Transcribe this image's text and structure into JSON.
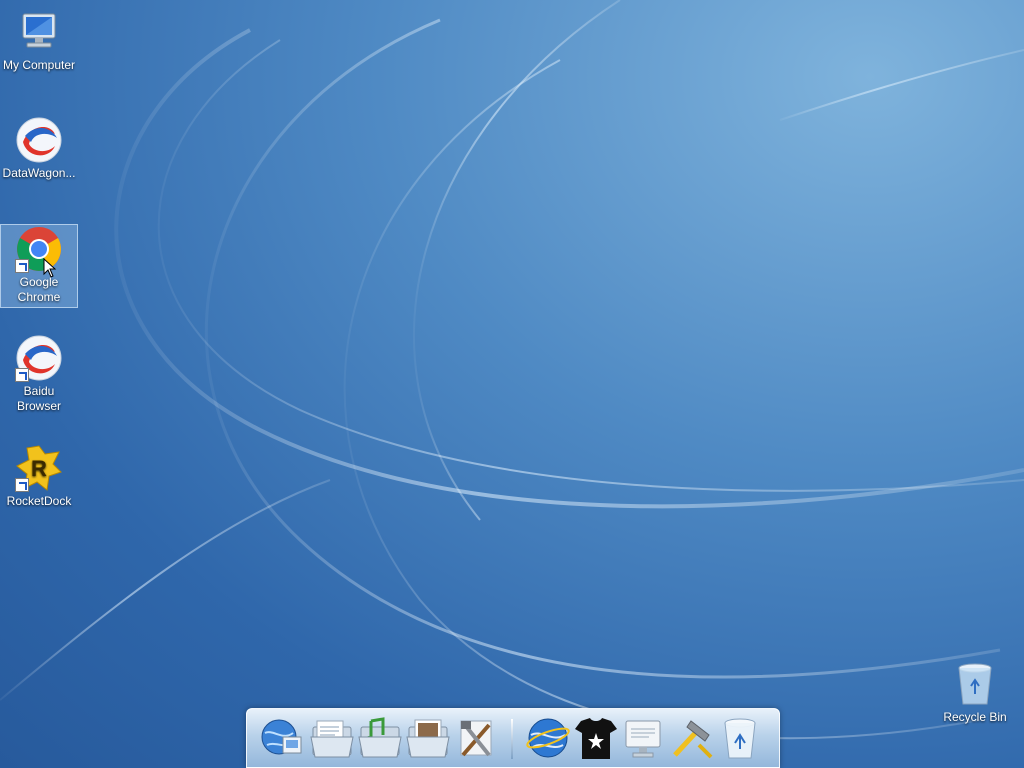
{
  "desktop": {
    "icons": [
      {
        "label": "My Computer",
        "icon": "computer-icon"
      },
      {
        "label": "DataWagon...",
        "icon": "datawagon-icon"
      },
      {
        "label": "Google\nChrome",
        "line1": "Google",
        "line2": "Chrome",
        "icon": "chrome-icon",
        "selected": true
      },
      {
        "label": "Baidu\nBrowser",
        "line1": "Baidu",
        "line2": "Browser",
        "icon": "baidu-browser-icon"
      },
      {
        "label": "RocketDock",
        "icon": "rocketdock-icon"
      }
    ],
    "recycle_bin": {
      "label": "Recycle Bin",
      "icon": "recycle-bin-icon"
    }
  },
  "dock": {
    "items": [
      {
        "name": "globe-network-icon"
      },
      {
        "name": "documents-folder-icon"
      },
      {
        "name": "music-folder-icon"
      },
      {
        "name": "pictures-folder-icon"
      },
      {
        "name": "tools-icon"
      },
      {
        "name": "internet-globe-icon"
      },
      {
        "name": "tshirt-icon"
      },
      {
        "name": "monitor-settings-icon"
      },
      {
        "name": "hammer-icon"
      },
      {
        "name": "recycle-bin-icon"
      }
    ]
  },
  "colors": {
    "accent": "#2f67ab",
    "dock": "#b9d2ea"
  }
}
